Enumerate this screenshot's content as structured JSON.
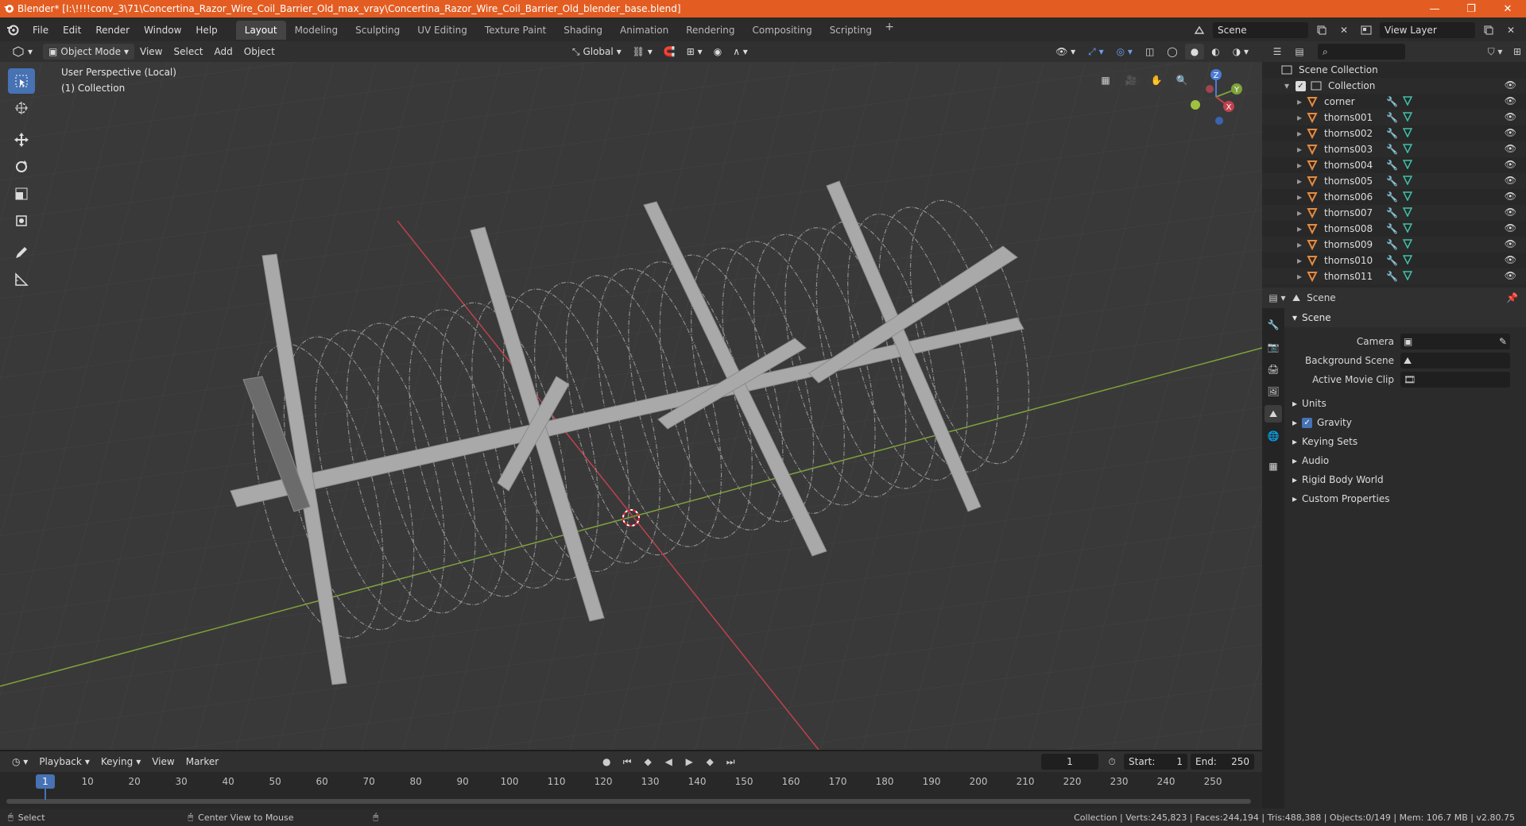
{
  "window": {
    "title": "Blender* [I:\\!!!!conv_3\\71\\Concertina_Razor_Wire_Coil_Barrier_Old_max_vray\\Concertina_Razor_Wire_Coil_Barrier_Old_blender_base.blend]",
    "minimize": "—",
    "maximize": "❐",
    "close": "✕"
  },
  "menu": [
    "File",
    "Edit",
    "Render",
    "Window",
    "Help"
  ],
  "workspaces": [
    "Layout",
    "Modeling",
    "Sculpting",
    "UV Editing",
    "Texture Paint",
    "Shading",
    "Animation",
    "Rendering",
    "Compositing",
    "Scripting"
  ],
  "active_workspace": "Layout",
  "scene_field": "Scene",
  "view_layer_field": "View Layer",
  "viewport_header": {
    "mode": "Object Mode",
    "menus": [
      "View",
      "Select",
      "Add",
      "Object"
    ],
    "transform": "Global"
  },
  "viewport": {
    "perspective": "User Perspective (Local)",
    "collection": "(1) Collection",
    "gizmo_axes": [
      "Z",
      "Y",
      "X"
    ]
  },
  "outliner": {
    "root": "Scene Collection",
    "collection": "Collection",
    "objects": [
      "corner",
      "thorns001",
      "thorns002",
      "thorns003",
      "thorns004",
      "thorns005",
      "thorns006",
      "thorns007",
      "thorns008",
      "thorns009",
      "thorns010",
      "thorns011"
    ]
  },
  "properties": {
    "header": "Scene",
    "panel": "Scene",
    "fields": [
      {
        "label": "Camera"
      },
      {
        "label": "Background Scene"
      },
      {
        "label": "Active Movie Clip"
      }
    ],
    "sections": [
      "Units",
      "Gravity",
      "Keying Sets",
      "Audio",
      "Rigid Body World",
      "Custom Properties"
    ]
  },
  "timeline": {
    "menus": [
      "Playback",
      "Keying",
      "View",
      "Marker"
    ],
    "current_frame": "1",
    "start_label": "Start:",
    "start": "1",
    "end_label": "End:",
    "end": "250",
    "ruler": [
      "1",
      "10",
      "20",
      "30",
      "40",
      "50",
      "60",
      "70",
      "80",
      "90",
      "100",
      "110",
      "120",
      "130",
      "140",
      "150",
      "160",
      "170",
      "180",
      "190",
      "200",
      "210",
      "220",
      "230",
      "240",
      "250"
    ]
  },
  "status": {
    "left_action": "Select",
    "middle_action": "Center View to Mouse",
    "stats": "Collection | Verts:245,823 | Faces:244,194 | Tris:488,388 | Objects:0/149 | Mem: 106.7 MB | v2.80.75"
  },
  "colors": {
    "accent": "#4772b3",
    "titlebar": "#e35d22",
    "x_axis": "#c0414d",
    "y_axis": "#7ea33a",
    "z_axis": "#4b7bd6",
    "object_orange": "#e88a3c",
    "mesh_green": "#3fc1a8"
  }
}
